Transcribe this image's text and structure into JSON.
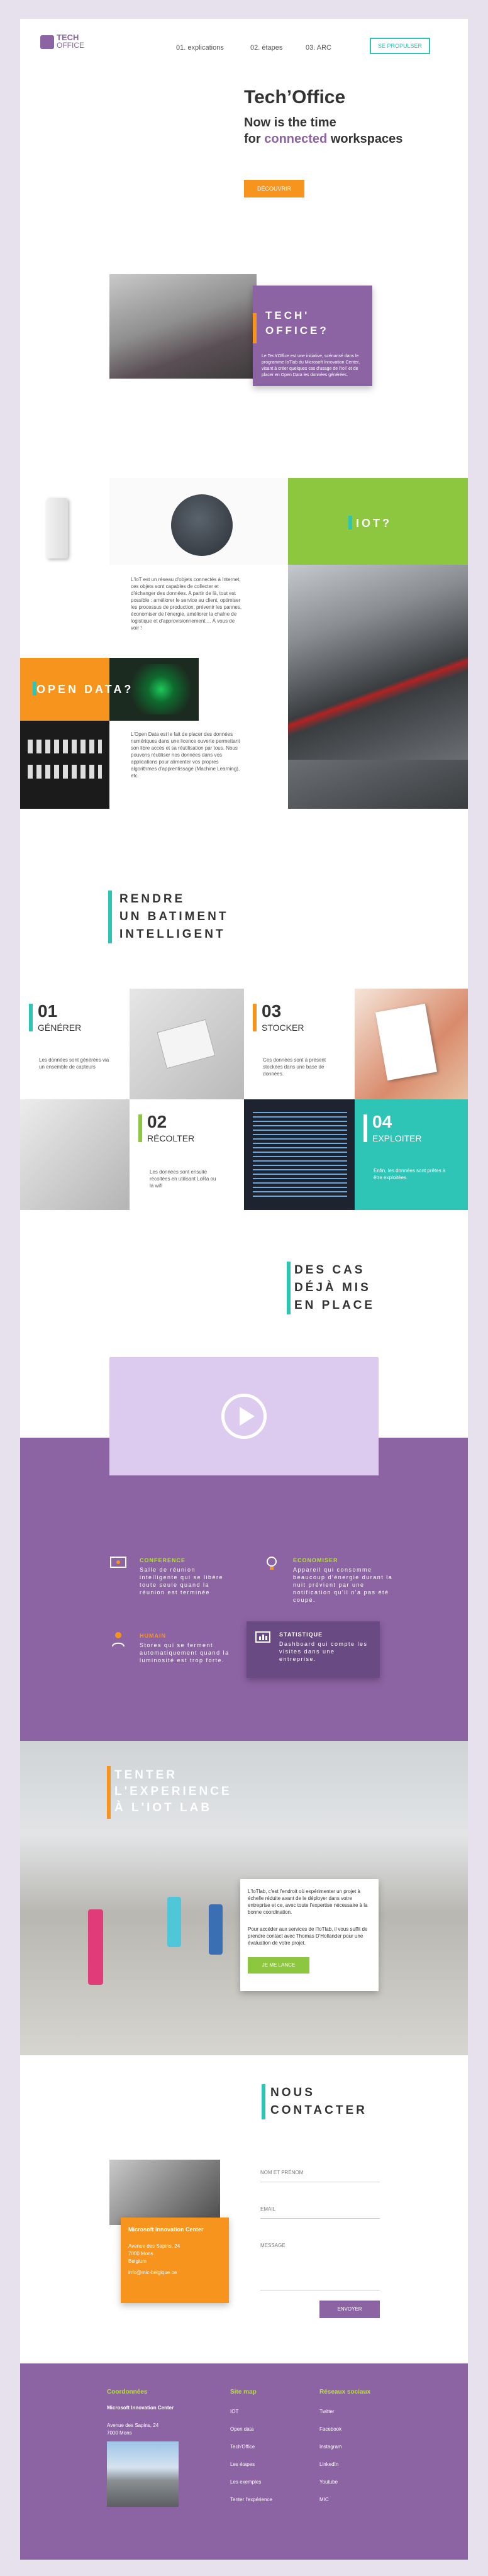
{
  "header": {
    "logo_line1": "TECH",
    "logo_line2": "OFFICE",
    "nav": [
      "01. explications",
      "02. étapes",
      "03. ARC"
    ],
    "cta": "SE PROPULSER"
  },
  "hero": {
    "title": "Tech’Office",
    "subtitle_1": "Now is the time",
    "subtitle_2_pre": "for",
    "subtitle_2_accent": "connected",
    "subtitle_2_post": "workspaces",
    "button": "DÉCOUVRIR"
  },
  "about": {
    "title_1": "TECH'",
    "title_2": "OFFICE?",
    "text": "Le Tech'Office est une initiative, scénarisé dans le programme IoTlab du Microsoft Innovation Center, visant à créer quelques cas d'usage de l'IoT et de placer en Open Data les données générées."
  },
  "iot": {
    "title": "IOT?",
    "text": "L'IoT est un réseau d'objets connectés à Internet, ces objets sont capables de collecter et d'échanger des données. A partir de là, tout est possible : améliorer le service au client, optimiser les processus de production, prévenir les pannes, économiser de l'énergie, améliorer la chaîne de logistique et d'approvisionnement.... À vous de voir !"
  },
  "opendata": {
    "title": "OPEN DATA?",
    "text": "L'Open Data est le fait de placer des données numériques dans une licence ouverte permettant son libre accès et sa réutilisation par tous. Nous pouvons réutiliser nos données dans vos applications pour alimenter vos propres algorithmes d'apprentissage (Machine Learning), etc."
  },
  "smart": {
    "line1": "RENDRE",
    "line2": "UN BATIMENT",
    "line3": "INTELLIGENT"
  },
  "steps": [
    {
      "num": "01",
      "label": "GÉNÉRER",
      "text": "Les données sont générées via un ensemble de capteurs"
    },
    {
      "num": "03",
      "label": "STOCKER",
      "text": "Ces données sont à présent stockées dans une base de données."
    },
    {
      "num": "02",
      "label": "RÉCOLTER",
      "text": "Les données sont ensuite récoltées en utilisant LoRa ou la wifi"
    },
    {
      "num": "04",
      "label": "EXPLOITER",
      "text": "Enfin, les données sont prêtes à être exploitées."
    }
  ],
  "cases": {
    "line1": "DES CAS",
    "line2": "DÉJÀ MIS",
    "line3": "EN PLACE"
  },
  "services": [
    {
      "title": "CONFERENCE",
      "text": "Salle de réunion intelligente qui se libère toute seule quand la réunion est terminée",
      "icon": "conference-icon"
    },
    {
      "title": "ECONOMISER",
      "text": "Appareil qui consomme beaucoup d'énergie durant la nuit prévient par une notification qu'il n'a pas été coupé.",
      "icon": "lightbulb-icon"
    },
    {
      "title": "HUMAIN",
      "text": "Stores qui se ferment automatiquement quand la luminosité est trop forte.",
      "icon": "person-icon"
    },
    {
      "title": "STATISTIQUE",
      "text": "Dashboard qui compte les visites dans une entreprise.",
      "icon": "dashboard-icon"
    }
  ],
  "lab": {
    "line1": "TENTER",
    "line2": "L'EXPERIENCE",
    "line3": "À L'IOT LAB",
    "text1": "L'IoTlab, c'est l'endroit où expérimenter un projet à échelle réduite avant de le déployer dans votre entreprise et ce, avec toute l'expertise nécessaire à la bonne coordination.",
    "text2": "Pour accéder aux services de l'IoTlab, il vous suffit de prendre contact avec Thomas D'Hollander pour une évaluation de votre projet.",
    "button": "JE ME LANCE"
  },
  "contact": {
    "line1": "NOUS",
    "line2": "CONTACTER",
    "card_title": "Microsoft Innovation Center",
    "card_addr1": "Avenue des Sapins, 24",
    "card_addr2": "7000 Mons",
    "card_country": "Belgium",
    "card_email": "info@mic-belgique.be",
    "field_name": "NOM ET PRÉNOM",
    "field_email": "EMAIL",
    "field_message": "MESSAGE",
    "submit": "ENVOYER"
  },
  "footer": {
    "col1_title": "Coordonnées",
    "col1_name": "Microsoft Innovation Center",
    "col1_addr1": "Avenue des Sapins, 24",
    "col1_addr2": "7000 Mons",
    "col2_title": "Site map",
    "col2_links": [
      "IOT",
      "Open data",
      "Tech'Office",
      "Les étapes",
      "Les exemples",
      "Tenter l'expérience"
    ],
    "col3_title": "Réseaux sociaux",
    "col3_links": [
      "Twitter",
      "Facebook",
      "Instagram",
      "LinkedIn",
      "Youtube",
      "MIC"
    ]
  },
  "colors": {
    "purple": "#8c63a3",
    "orange": "#f7941d",
    "teal": "#2ec4b6",
    "green": "#8dc63f",
    "lime": "#b3e235"
  }
}
